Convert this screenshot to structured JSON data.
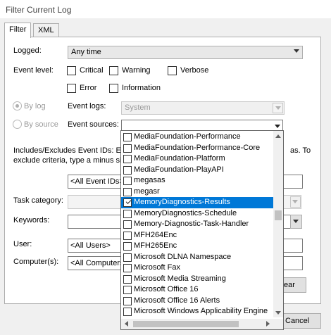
{
  "window": {
    "title": "Filter Current Log"
  },
  "tabs": [
    {
      "label": "Filter",
      "active": true
    },
    {
      "label": "XML",
      "active": false
    }
  ],
  "logged": {
    "label": "Logged:",
    "value": "Any time"
  },
  "event_level": {
    "label": "Event level:",
    "critical": "Critical",
    "warning": "Warning",
    "verbose": "Verbose",
    "error": "Error",
    "information": "Information"
  },
  "by_log": {
    "label": "By log",
    "event_logs_label": "Event logs:",
    "event_logs_value": "System"
  },
  "by_source": {
    "label": "By source",
    "event_sources_label": "Event sources:",
    "event_sources_value": ""
  },
  "event_ids": {
    "help_line1_start": "Includes/Excludes Event IDs: Enter",
    "help_line1_end": "as. To",
    "help_line2_start": "exclude criteria, type a minus sign",
    "value": "<All Event IDs>"
  },
  "task_category": {
    "label": "Task category:"
  },
  "keywords": {
    "label": "Keywords:"
  },
  "user": {
    "label": "User:",
    "value": "<All Users>"
  },
  "computers": {
    "label": "Computer(s):",
    "value": "<All Computers"
  },
  "buttons": {
    "clear_partial": "ear",
    "cancel": "Cancel"
  },
  "sources_list": [
    {
      "label": "MediaFoundation-Performance",
      "checked": false,
      "selected": false
    },
    {
      "label": "MediaFoundation-Performance-Core",
      "checked": false,
      "selected": false
    },
    {
      "label": "MediaFoundation-Platform",
      "checked": false,
      "selected": false
    },
    {
      "label": "MediaFoundation-PlayAPI",
      "checked": false,
      "selected": false
    },
    {
      "label": "megasas",
      "checked": false,
      "selected": false
    },
    {
      "label": "megasr",
      "checked": false,
      "selected": false
    },
    {
      "label": "MemoryDiagnostics-Results",
      "checked": true,
      "selected": true
    },
    {
      "label": "MemoryDiagnostics-Schedule",
      "checked": false,
      "selected": false
    },
    {
      "label": "Memory-Diagnostic-Task-Handler",
      "checked": false,
      "selected": false
    },
    {
      "label": "MFH264Enc",
      "checked": false,
      "selected": false
    },
    {
      "label": "MFH265Enc",
      "checked": false,
      "selected": false
    },
    {
      "label": "Microsoft DLNA Namespace",
      "checked": false,
      "selected": false
    },
    {
      "label": "Microsoft Fax",
      "checked": false,
      "selected": false
    },
    {
      "label": "Microsoft Media Streaming",
      "checked": false,
      "selected": false
    },
    {
      "label": "Microsoft Office 16",
      "checked": false,
      "selected": false
    },
    {
      "label": "Microsoft Office 16 Alerts",
      "checked": false,
      "selected": false
    },
    {
      "label": "Microsoft Windows Applicability Engine",
      "checked": false,
      "selected": false
    }
  ],
  "colors": {
    "selection": "#0078d7",
    "window_bg": "#f0f0f0"
  }
}
